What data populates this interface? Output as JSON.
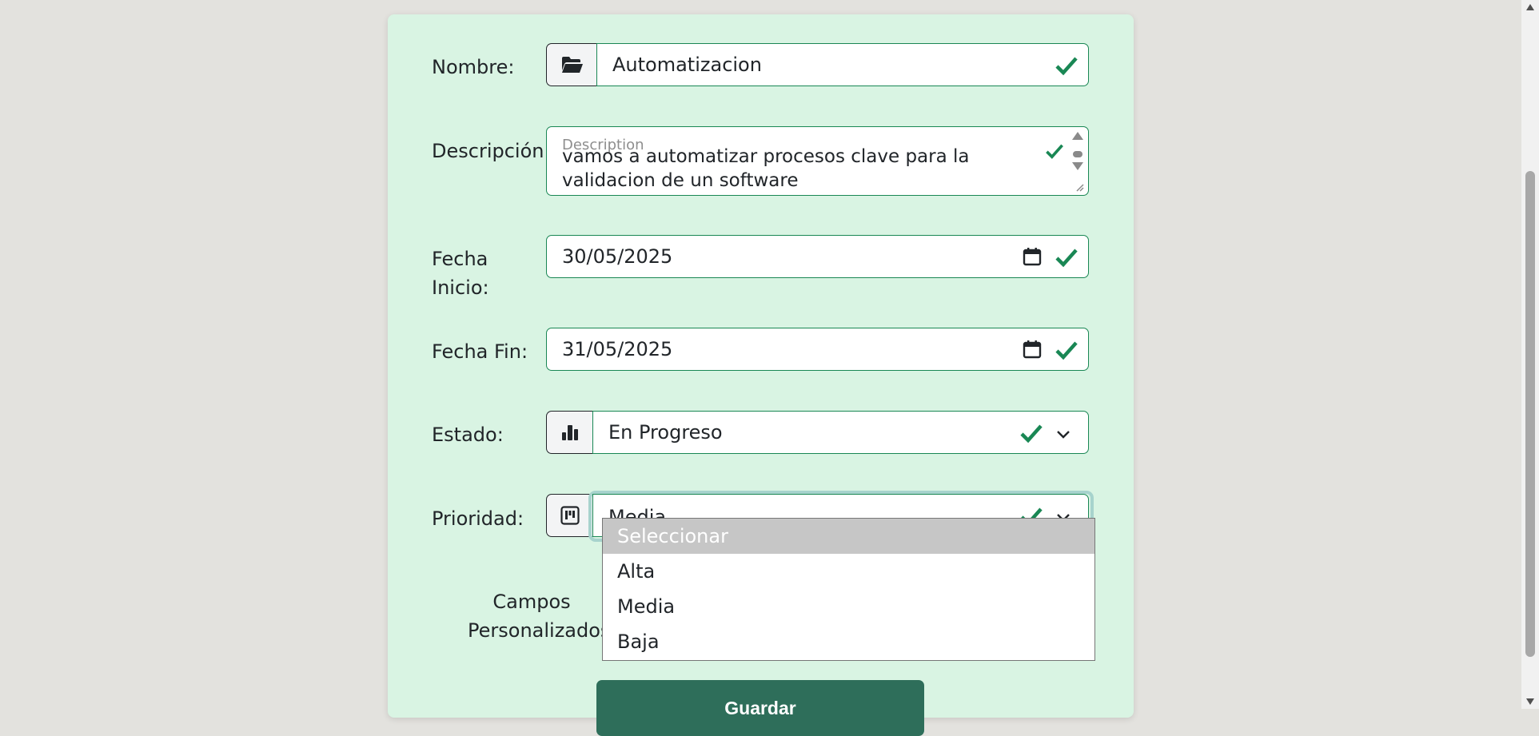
{
  "form": {
    "nombre": {
      "label": "Nombre:",
      "value": "Automatizacion",
      "icon": "folder-open-icon"
    },
    "descripcion": {
      "label": "Descripción:",
      "placeholder": "Description",
      "value": "vamos a automatizar procesos clave para la validacion de un software"
    },
    "fecha_inicio": {
      "label_line1": "Fecha",
      "label_line2": "Inicio:",
      "value": "30/05/2025"
    },
    "fecha_fin": {
      "label": "Fecha Fin:",
      "value": "31/05/2025"
    },
    "estado": {
      "label": "Estado:",
      "value": "En Progreso",
      "icon": "bar-chart-icon"
    },
    "prioridad": {
      "label": "Prioridad:",
      "value": "Media",
      "icon": "kanban-icon",
      "options": [
        "Seleccionar",
        "Alta",
        "Media",
        "Baja"
      ],
      "highlighted_option": "Seleccionar"
    },
    "campos": {
      "label_line1": "Campos",
      "label_line2": "Personalizados:"
    },
    "save_label": "Guardar"
  },
  "colors": {
    "card_bg": "#d9f4e3",
    "valid_green": "#198754",
    "button_bg": "#2e6e5a",
    "page_bg": "#e3e2de"
  }
}
